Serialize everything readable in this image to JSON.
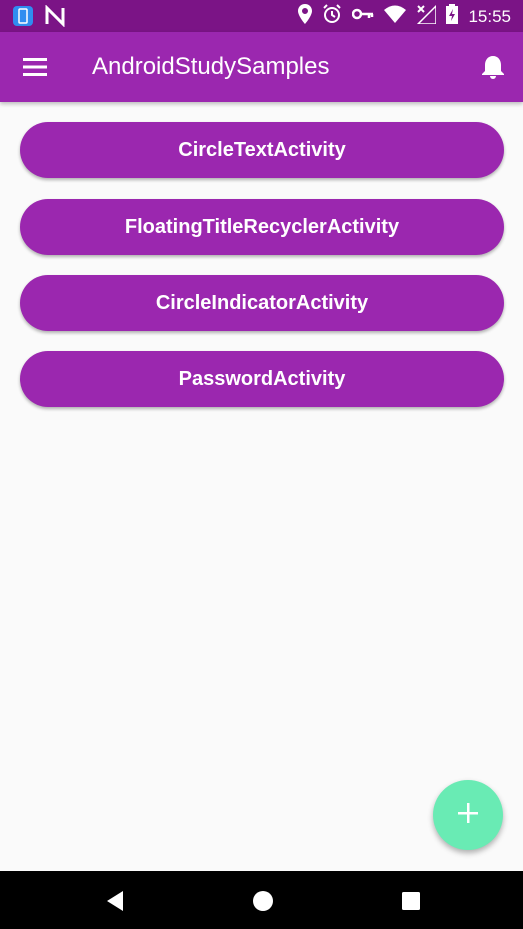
{
  "status_bar": {
    "time": "15:55",
    "icons_left": [
      "phone-screen-icon",
      "n-logo-icon"
    ],
    "icons_right": [
      "location-icon",
      "alarm-icon",
      "key-icon",
      "wifi-icon",
      "no-signal-icon",
      "battery-charging-icon"
    ]
  },
  "app_bar": {
    "title": "AndroidStudySamples",
    "menu_icon": "hamburger-menu-icon",
    "notification_icon": "bell-icon"
  },
  "buttons": [
    {
      "label": "CircleTextActivity"
    },
    {
      "label": "FloatingTitleRecyclerActivity"
    },
    {
      "label": "CircleIndicatorActivity"
    },
    {
      "label": "PasswordActivity"
    }
  ],
  "fab": {
    "icon": "plus-icon"
  },
  "nav_bar": {
    "icons": [
      "back-icon",
      "home-icon",
      "recents-icon"
    ]
  },
  "colors": {
    "status_bar": "#7b1486",
    "primary": "#9b27af",
    "accent": "#69ebb4",
    "background": "#fafafa"
  }
}
